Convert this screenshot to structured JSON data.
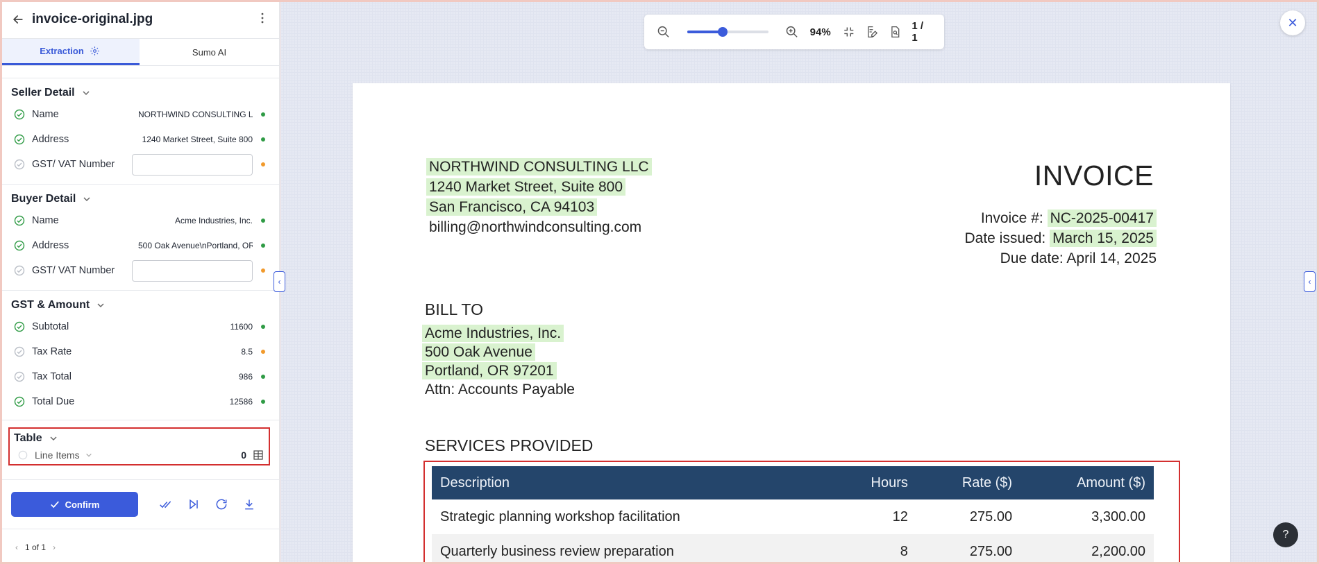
{
  "header": {
    "title": "invoice-original.jpg"
  },
  "tabs": [
    {
      "label": "Extraction"
    },
    {
      "label": "Sumo AI"
    }
  ],
  "sections": {
    "seller": {
      "title": "Seller Detail",
      "name": {
        "label": "Name",
        "value": "NORTHWIND CONSULTING LLC"
      },
      "address": {
        "label": "Address",
        "value": "1240 Market Street, Suite 800"
      },
      "gst": {
        "label": "GST/ VAT Number",
        "value": ""
      }
    },
    "buyer": {
      "title": "Buyer Detail",
      "name": {
        "label": "Name",
        "value": "Acme Industries, Inc."
      },
      "address": {
        "label": "Address",
        "value": "500 Oak Avenue\\nPortland, OR 97201"
      },
      "gst": {
        "label": "GST/ VAT Number",
        "value": ""
      }
    },
    "amount": {
      "title": "GST & Amount",
      "subtotal": {
        "label": "Subtotal",
        "value": "11600"
      },
      "tax_rate": {
        "label": "Tax Rate",
        "value": "8.5"
      },
      "tax_total": {
        "label": "Tax Total",
        "value": "986"
      },
      "total_due": {
        "label": "Total Due",
        "value": "12586"
      }
    },
    "table": {
      "title": "Table",
      "line_items": {
        "label": "Line Items",
        "count": "0"
      }
    }
  },
  "actions": {
    "confirm_label": "Confirm"
  },
  "pager": {
    "text": "1 of 1"
  },
  "viewer": {
    "zoom": "94%",
    "zoom_level": 0.44,
    "page": "1 / 1"
  },
  "invoice": {
    "seller_lines": [
      "NORTHWIND CONSULTING LLC",
      "1240 Market Street, Suite 800",
      "San Francisco, CA 94103",
      "billing@northwindconsulting.com"
    ],
    "title": "INVOICE",
    "invoice_no_label": "Invoice #:",
    "invoice_no": "NC-2025-00417",
    "date_label": "Date issued:",
    "date": "March 15, 2025",
    "due_label": "Due date:",
    "due": "April 14, 2025",
    "bill_to": "BILL TO",
    "buyer_lines": [
      "Acme Industries, Inc.",
      "500 Oak Avenue",
      "Portland, OR 97201",
      "Attn: Accounts Payable"
    ],
    "services_title": "SERVICES PROVIDED",
    "columns": [
      "Description",
      "Hours",
      "Rate ($)",
      "Amount ($)"
    ],
    "rows": [
      [
        "Strategic planning workshop facilitation",
        "12",
        "275.00",
        "3,300.00"
      ],
      [
        "Quarterly business review preparation",
        "8",
        "275.00",
        "2,200.00"
      ]
    ]
  },
  "colors": {
    "accent": "#3b5bdb",
    "ok": "#2f9b45",
    "warn": "#f19a2c",
    "highlight": "#d9f2cf",
    "table_header": "#24456b",
    "annotation": "#d32f2f"
  }
}
